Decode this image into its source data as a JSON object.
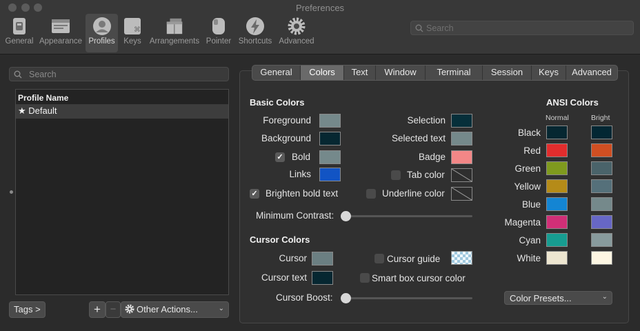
{
  "window": {
    "title": "Preferences"
  },
  "colors": {
    "accent": "#4a4a4a",
    "checkbox_on": "#5a5a5a"
  },
  "toolbar": {
    "items": [
      {
        "label": "General",
        "icon": "switch-icon"
      },
      {
        "label": "Appearance",
        "icon": "window-icon"
      },
      {
        "label": "Profiles",
        "icon": "person-icon",
        "selected": true
      },
      {
        "label": "Keys",
        "icon": "command-key-icon"
      },
      {
        "label": "Arrangements",
        "icon": "stacked-windows-icon"
      },
      {
        "label": "Pointer",
        "icon": "mouse-icon"
      },
      {
        "label": "Shortcuts",
        "icon": "lightning-icon"
      },
      {
        "label": "Advanced",
        "icon": "gear-icon"
      }
    ],
    "search_placeholder": "Search"
  },
  "profiles": {
    "search_placeholder": "Search",
    "column_header": "Profile Name",
    "items": [
      {
        "name": "Default",
        "default": true
      }
    ],
    "tags_label": "Tags >",
    "add_label": "+",
    "remove_label": "−",
    "other_actions_label": "Other Actions..."
  },
  "tabs": [
    "General",
    "Colors",
    "Text",
    "Window",
    "Terminal",
    "Session",
    "Keys",
    "Advanced"
  ],
  "active_tab": "Colors",
  "basic_colors": {
    "header": "Basic Colors",
    "foreground": {
      "label": "Foreground",
      "color": "#75898b"
    },
    "background": {
      "label": "Background",
      "color": "#062731"
    },
    "bold": {
      "label": "Bold",
      "color": "#75898b",
      "checked": true
    },
    "links": {
      "label": "Links",
      "color": "#1254c4"
    },
    "selection": {
      "label": "Selection",
      "color": "#062f3a"
    },
    "selected_text": {
      "label": "Selected text",
      "color": "#75898b"
    },
    "badge": {
      "label": "Badge",
      "color": "#f28787"
    },
    "tab_color": {
      "label": "Tab color",
      "checked": false
    },
    "brighten_bold": {
      "label": "Brighten bold text",
      "checked": true
    },
    "underline_color": {
      "label": "Underline color",
      "checked": false
    },
    "minimum_contrast": {
      "label": "Minimum Contrast:",
      "value": 0
    }
  },
  "cursor_colors": {
    "header": "Cursor Colors",
    "cursor": {
      "label": "Cursor",
      "color": "#6b7f82"
    },
    "cursor_text": {
      "label": "Cursor text",
      "color": "#062731"
    },
    "cursor_guide": {
      "label": "Cursor guide",
      "checked": false,
      "color": "#b7dcef"
    },
    "smart_box": {
      "label": "Smart box cursor color",
      "checked": false
    },
    "cursor_boost": {
      "label": "Cursor Boost:",
      "value": 0
    }
  },
  "ansi": {
    "header": "ANSI Colors",
    "normal_label": "Normal",
    "bright_label": "Bright",
    "rows": [
      {
        "name": "Black",
        "normal": "#062731",
        "bright": "#032733"
      },
      {
        "name": "Red",
        "normal": "#e22d2d",
        "bright": "#d04f22"
      },
      {
        "name": "Green",
        "normal": "#7f9a1e",
        "bright": "#4a636a"
      },
      {
        "name": "Yellow",
        "normal": "#b58b18",
        "bright": "#55707a"
      },
      {
        "name": "Blue",
        "normal": "#1485d3",
        "bright": "#75898b"
      },
      {
        "name": "Magenta",
        "normal": "#d12f77",
        "bright": "#6767c5"
      },
      {
        "name": "Cyan",
        "normal": "#179d91",
        "bright": "#889b9d"
      },
      {
        "name": "White",
        "normal": "#ede6d0",
        "bright": "#fdf6e3"
      }
    ],
    "presets_label": "Color Presets..."
  }
}
